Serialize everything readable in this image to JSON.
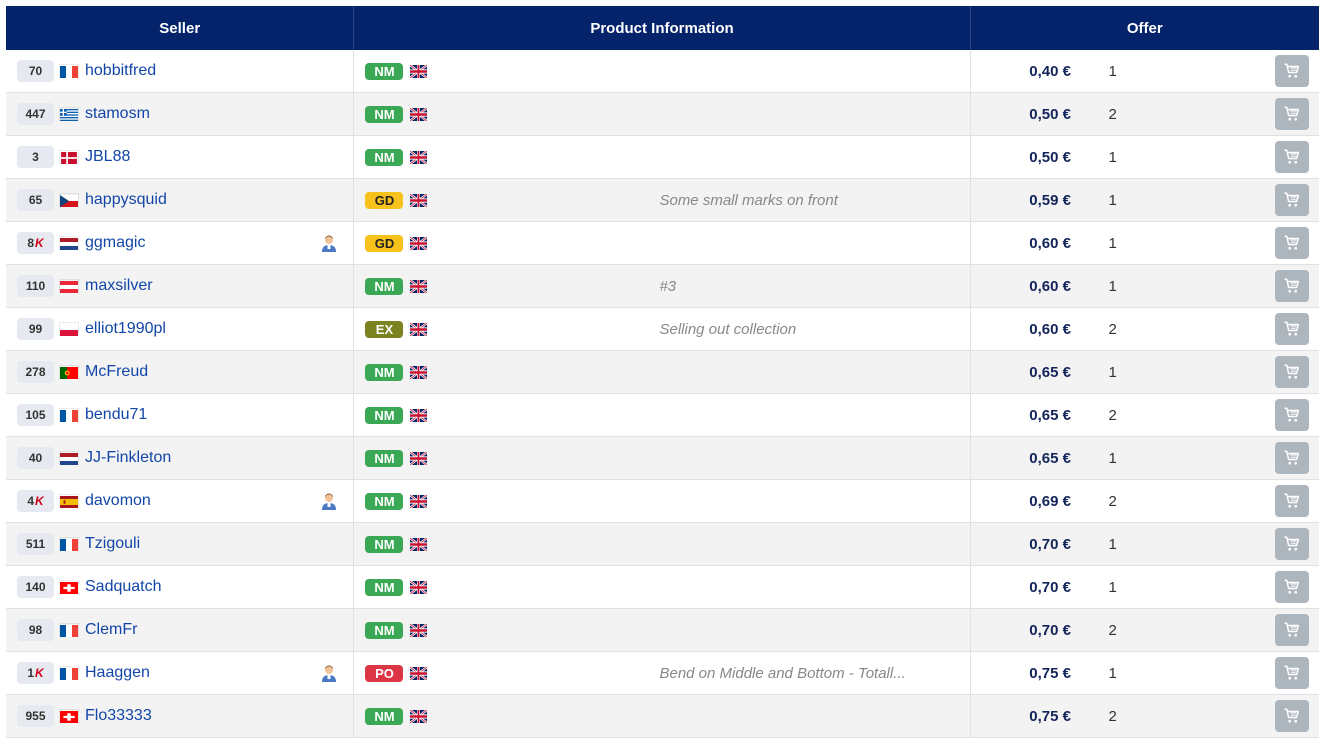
{
  "header": {
    "seller": "Seller",
    "product": "Product Information",
    "offer": "Offer"
  },
  "rows": [
    {
      "rating": "70",
      "k": "",
      "country": "fr",
      "seller": "hobbitfred",
      "pro": false,
      "condition": "NM",
      "comment": "",
      "price": "0,40 €",
      "qty": "1"
    },
    {
      "rating": "447",
      "k": "",
      "country": "gr",
      "seller": "stamosm",
      "pro": false,
      "condition": "NM",
      "comment": "",
      "price": "0,50 €",
      "qty": "2"
    },
    {
      "rating": "3",
      "k": "",
      "country": "dk",
      "seller": "JBL88",
      "pro": false,
      "condition": "NM",
      "comment": "",
      "price": "0,50 €",
      "qty": "1"
    },
    {
      "rating": "65",
      "k": "",
      "country": "cz",
      "seller": "happysquid",
      "pro": false,
      "condition": "GD",
      "comment": "Some small marks on front",
      "price": "0,59 €",
      "qty": "1"
    },
    {
      "rating": "8",
      "k": "K",
      "country": "nl",
      "seller": "ggmagic",
      "pro": true,
      "condition": "GD",
      "comment": "",
      "price": "0,60 €",
      "qty": "1"
    },
    {
      "rating": "110",
      "k": "",
      "country": "at",
      "seller": "maxsilver",
      "pro": false,
      "condition": "NM",
      "comment": "#3",
      "price": "0,60 €",
      "qty": "1"
    },
    {
      "rating": "99",
      "k": "",
      "country": "pl",
      "seller": "elliot1990pl",
      "pro": false,
      "condition": "EX",
      "comment": "Selling out collection",
      "price": "0,60 €",
      "qty": "2"
    },
    {
      "rating": "278",
      "k": "",
      "country": "pt",
      "seller": "McFreud",
      "pro": false,
      "condition": "NM",
      "comment": "",
      "price": "0,65 €",
      "qty": "1"
    },
    {
      "rating": "105",
      "k": "",
      "country": "fr",
      "seller": "bendu71",
      "pro": false,
      "condition": "NM",
      "comment": "",
      "price": "0,65 €",
      "qty": "2"
    },
    {
      "rating": "40",
      "k": "",
      "country": "nl",
      "seller": "JJ-Finkleton",
      "pro": false,
      "condition": "NM",
      "comment": "",
      "price": "0,65 €",
      "qty": "1"
    },
    {
      "rating": "4",
      "k": "K",
      "country": "es",
      "seller": "davomon",
      "pro": true,
      "condition": "NM",
      "comment": "",
      "price": "0,69 €",
      "qty": "2"
    },
    {
      "rating": "511",
      "k": "",
      "country": "fr",
      "seller": "Tzigouli",
      "pro": false,
      "condition": "NM",
      "comment": "",
      "price": "0,70 €",
      "qty": "1"
    },
    {
      "rating": "140",
      "k": "",
      "country": "ch",
      "seller": "Sadquatch",
      "pro": false,
      "condition": "NM",
      "comment": "",
      "price": "0,70 €",
      "qty": "1"
    },
    {
      "rating": "98",
      "k": "",
      "country": "fr",
      "seller": "ClemFr",
      "pro": false,
      "condition": "NM",
      "comment": "",
      "price": "0,70 €",
      "qty": "2"
    },
    {
      "rating": "1",
      "k": "K",
      "country": "fr",
      "seller": "Haaggen",
      "pro": true,
      "condition": "PO",
      "comment": "Bend on Middle and Bottom - Totall...",
      "price": "0,75 €",
      "qty": "1"
    },
    {
      "rating": "955",
      "k": "",
      "country": "ch",
      "seller": "Flo33333",
      "pro": false,
      "condition": "NM",
      "comment": "",
      "price": "0,75 €",
      "qty": "2"
    }
  ],
  "icons": {
    "cart": "shopping-cart-icon",
    "language": "uk-flag-icon",
    "professional": "professional-seller-icon"
  },
  "colors": {
    "header_bg": "#04236b",
    "link": "#1246a8",
    "price": "#13245a",
    "cart_button": "#adb5bd"
  }
}
